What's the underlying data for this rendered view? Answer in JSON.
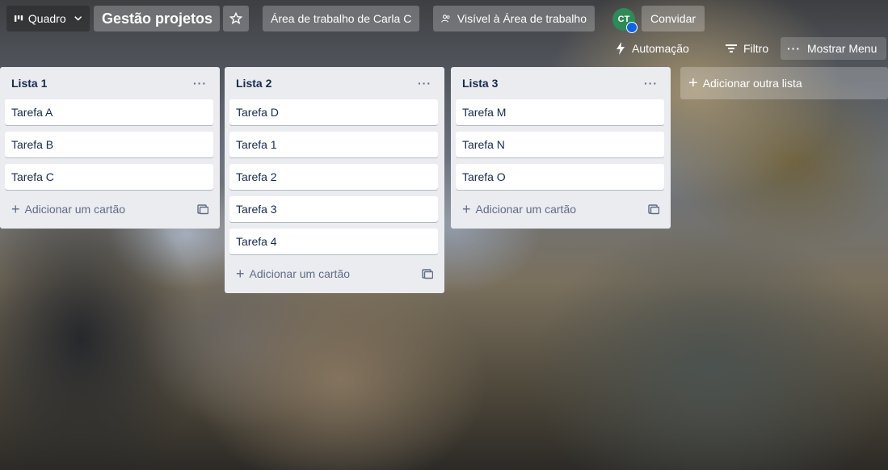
{
  "topbar": {
    "view_label": "Quadro",
    "board_title": "Gestão projetos",
    "workspace": "Área de trabalho de Carla C",
    "visibility": "Visível à Área de trabalho",
    "avatar_initials": "CT",
    "invite_label": "Convidar"
  },
  "toolbar": {
    "automation": "Automação",
    "filter": "Filtro",
    "menu": "Mostrar Menu"
  },
  "lists": [
    {
      "title": "Lista 1",
      "cards": [
        "Tarefa A",
        "Tarefa B",
        "Tarefa C"
      ],
      "add_label": "Adicionar um cartão"
    },
    {
      "title": "Lista 2",
      "cards": [
        "Tarefa D",
        "Tarefa 1",
        "Tarefa 2",
        "Tarefa 3",
        "Tarefa 4"
      ],
      "add_label": "Adicionar um cartão"
    },
    {
      "title": "Lista 3",
      "cards": [
        "Tarefa M",
        "Tarefa N",
        "Tarefa O"
      ],
      "add_label": "Adicionar um cartão"
    }
  ],
  "add_list_label": "Adicionar outra lista",
  "colors": {
    "list_bg": "#ebecf0",
    "card_text": "#172b4d",
    "avatar_bg": "#2e8b57"
  }
}
